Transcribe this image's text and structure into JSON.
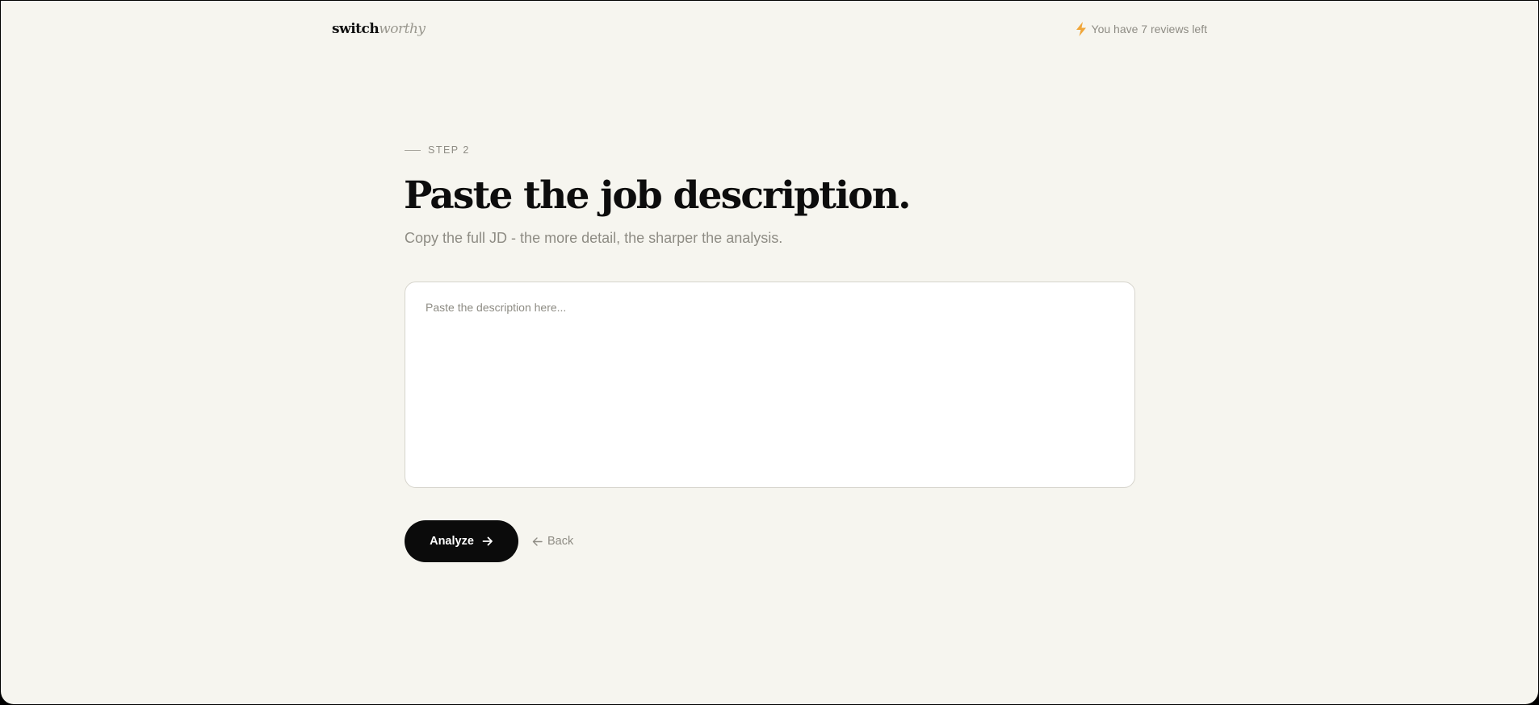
{
  "header": {
    "logo_part1": "switch",
    "logo_part2": "worthy",
    "credits_text": "You have 7 reviews left",
    "credits_icon": "lightning-icon",
    "credits_icon_color": "#f0a63a"
  },
  "main": {
    "step_label": "STEP 2",
    "title": "Paste the job description.",
    "subtitle": "Copy the full JD - the more detail, the sharper the analysis.",
    "textarea": {
      "value": "",
      "placeholder": "Paste the description here..."
    },
    "analyze_label": "Analyze",
    "analyze_icon": "arrow-right-icon",
    "back_label": "Back",
    "back_icon": "arrow-left-icon"
  },
  "colors": {
    "background": "#f6f5ef",
    "primary_button": "#0b0b0b",
    "muted_text": "#8e8c84"
  }
}
